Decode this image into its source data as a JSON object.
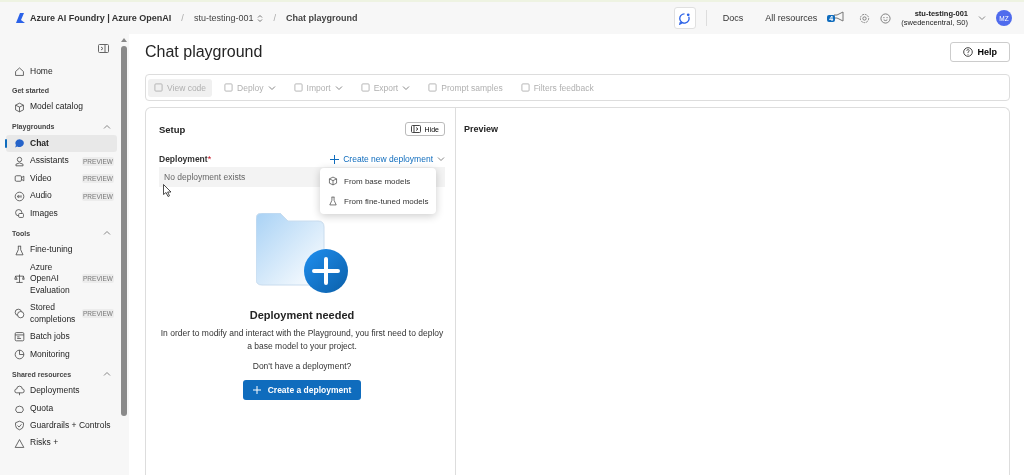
{
  "topbar": {
    "brand": "Azure AI Foundry | Azure OpenAI",
    "breadcrumbs": [
      {
        "separator": "/",
        "label": "stu-testing-001",
        "switcher": true
      },
      {
        "separator": "/",
        "label": "Chat playground",
        "switcher": false
      }
    ],
    "links": [
      "Docs",
      "All resources"
    ],
    "notification_count": "4",
    "account": {
      "name": "stu-testing-001",
      "region": "(swedencentral, S0)",
      "initials": "MZ"
    }
  },
  "sidebar": {
    "items": [
      {
        "kind": "item",
        "label": "Home",
        "selected": false
      },
      {
        "kind": "section",
        "label": "Get started"
      },
      {
        "kind": "item",
        "label": "Model catalog",
        "selected": false
      },
      {
        "kind": "section",
        "label": "Playgrounds",
        "expanded": true
      },
      {
        "kind": "item",
        "label": "Chat",
        "selected": true
      },
      {
        "kind": "item",
        "label": "Assistants",
        "badge": "PREVIEW",
        "selected": false
      },
      {
        "kind": "item",
        "label": "Video",
        "badge": "PREVIEW",
        "selected": false
      },
      {
        "kind": "item",
        "label": "Audio",
        "badge": "PREVIEW",
        "selected": false
      },
      {
        "kind": "item",
        "label": "Images",
        "selected": false
      },
      {
        "kind": "section",
        "label": "Tools",
        "expanded": true
      },
      {
        "kind": "item",
        "label": "Fine-tuning",
        "selected": false
      },
      {
        "kind": "item",
        "label": "Azure OpenAI Evaluation",
        "badge": "PREVIEW",
        "selected": false
      },
      {
        "kind": "item",
        "label": "Stored completions",
        "badge": "PREVIEW",
        "selected": false
      },
      {
        "kind": "item",
        "label": "Batch jobs",
        "selected": false
      },
      {
        "kind": "item",
        "label": "Monitoring",
        "selected": false
      },
      {
        "kind": "section",
        "label": "Shared resources",
        "expanded": true
      },
      {
        "kind": "item",
        "label": "Deployments",
        "selected": false
      },
      {
        "kind": "item",
        "label": "Quota",
        "selected": false
      },
      {
        "kind": "item",
        "label": "Guardrails + Controls",
        "selected": false
      },
      {
        "kind": "item",
        "label": "Risks +",
        "selected": false
      }
    ]
  },
  "page": {
    "title": "Chat playground",
    "help": "Help"
  },
  "toolbar": [
    {
      "label": "View code",
      "dropdown": false,
      "selected": true,
      "disabled": true
    },
    {
      "label": "Deploy",
      "dropdown": true,
      "selected": false,
      "disabled": true
    },
    {
      "label": "Import",
      "dropdown": true,
      "selected": false,
      "disabled": true
    },
    {
      "label": "Export",
      "dropdown": true,
      "selected": false,
      "disabled": true
    },
    {
      "label": "Prompt samples",
      "dropdown": false,
      "selected": false,
      "disabled": true
    },
    {
      "label": "Filters feedback",
      "dropdown": false,
      "selected": false,
      "disabled": true
    }
  ],
  "setup": {
    "title": "Setup",
    "hide": "Hide",
    "field_label": "Deployment",
    "required_mark": "*",
    "create_link": "Create new deployment",
    "placeholder": "No deployment exists",
    "menu": [
      "From base models",
      "From fine-tuned models"
    ],
    "empty_title": "Deployment needed",
    "empty_text": "In order to modify and interact with the Playground, you first need to deploy a base model to your project.",
    "prompt": "Don't have a deployment?",
    "button": "Create a deployment"
  },
  "preview": {
    "title": "Preview"
  }
}
